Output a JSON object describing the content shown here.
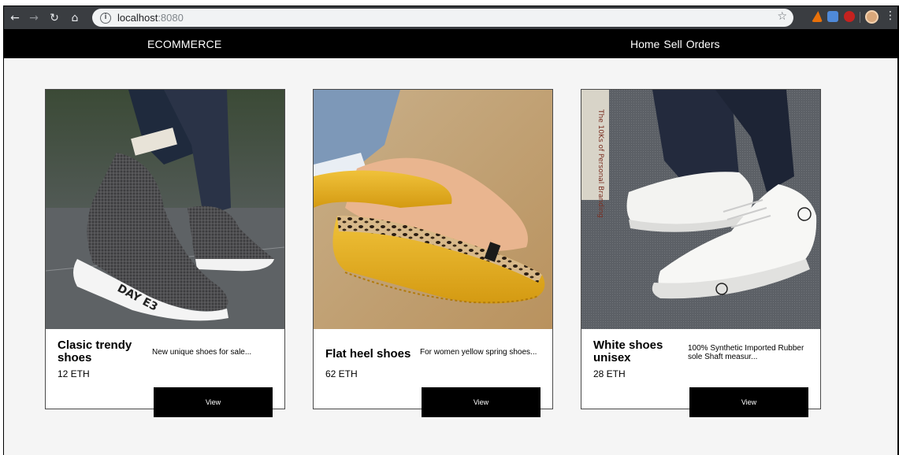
{
  "browser": {
    "url_host": "localhost",
    "url_port": ":8080"
  },
  "app": {
    "brand": "ECOMMERCE",
    "nav": [
      "Home",
      "Sell",
      "Orders"
    ]
  },
  "products": [
    {
      "title": "Clasic trendy shoes",
      "price": "12 ETH",
      "description": "New unique shoes for sale...",
      "button": "View",
      "image": "grey-knit-sneaker"
    },
    {
      "title": "Flat heel shoes",
      "price": "62 ETH",
      "description": "For women yellow spring shoes...",
      "button": "View",
      "image": "yellow-loafer"
    },
    {
      "title": "White shoes unisex",
      "price": "28 ETH",
      "description": "100% Synthetic Imported Rubber sole Shaft measur...",
      "button": "View",
      "image": "white-canvas-sneaker"
    }
  ]
}
